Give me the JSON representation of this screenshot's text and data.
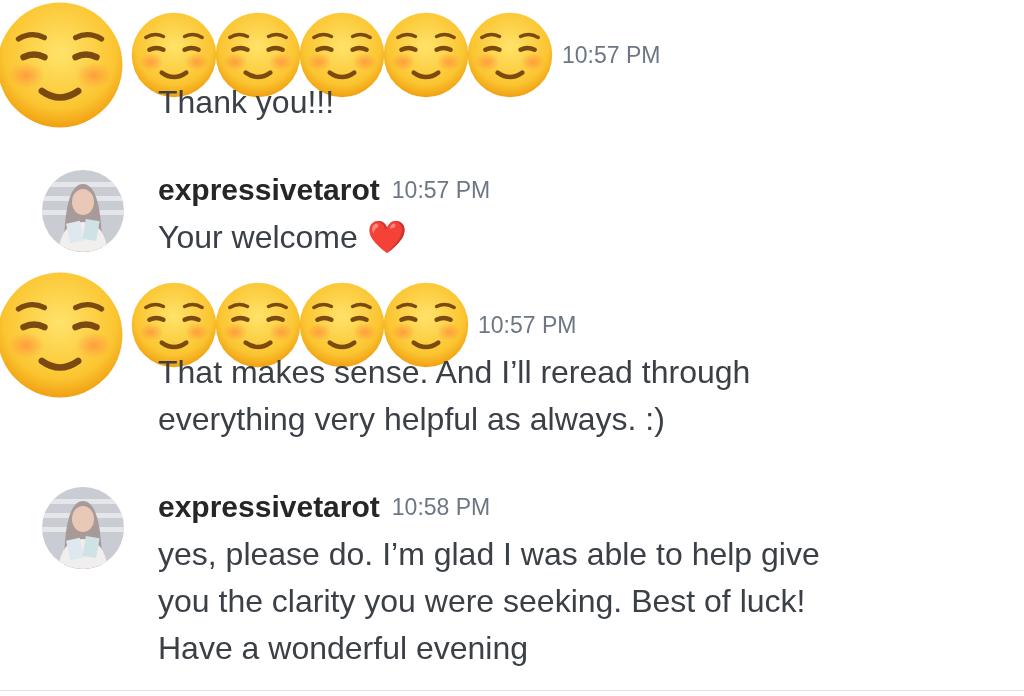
{
  "messages": [
    {
      "kind": "covered",
      "time": "10:57 PM",
      "lines": [
        "Thank you!!!"
      ],
      "stickers": [
        {
          "kind": "large"
        },
        {
          "kind": "small"
        },
        {
          "kind": "small"
        },
        {
          "kind": "small"
        },
        {
          "kind": "small"
        },
        {
          "kind": "small"
        }
      ]
    },
    {
      "kind": "named",
      "username": "expressivetarot",
      "time": "10:57 PM",
      "lines": [
        "Your welcome ❤️"
      ],
      "avatar": {
        "kind": "picture"
      }
    },
    {
      "kind": "covered",
      "time": "10:57 PM",
      "lines": [
        "That makes sense. And I’ll reread through",
        "everything very helpful as always. :)"
      ],
      "stickers": [
        {
          "kind": "large"
        },
        {
          "kind": "small"
        },
        {
          "kind": "small"
        },
        {
          "kind": "small"
        },
        {
          "kind": "small"
        }
      ]
    },
    {
      "kind": "named",
      "username": "expressivetarot",
      "time": "10:58 PM",
      "lines": [
        "yes, please do. I’m glad I was able to help give",
        "you the clarity you were seeking. Best of luck!",
        "Have a wonderful evening"
      ],
      "avatar": {
        "kind": "picture"
      }
    }
  ]
}
